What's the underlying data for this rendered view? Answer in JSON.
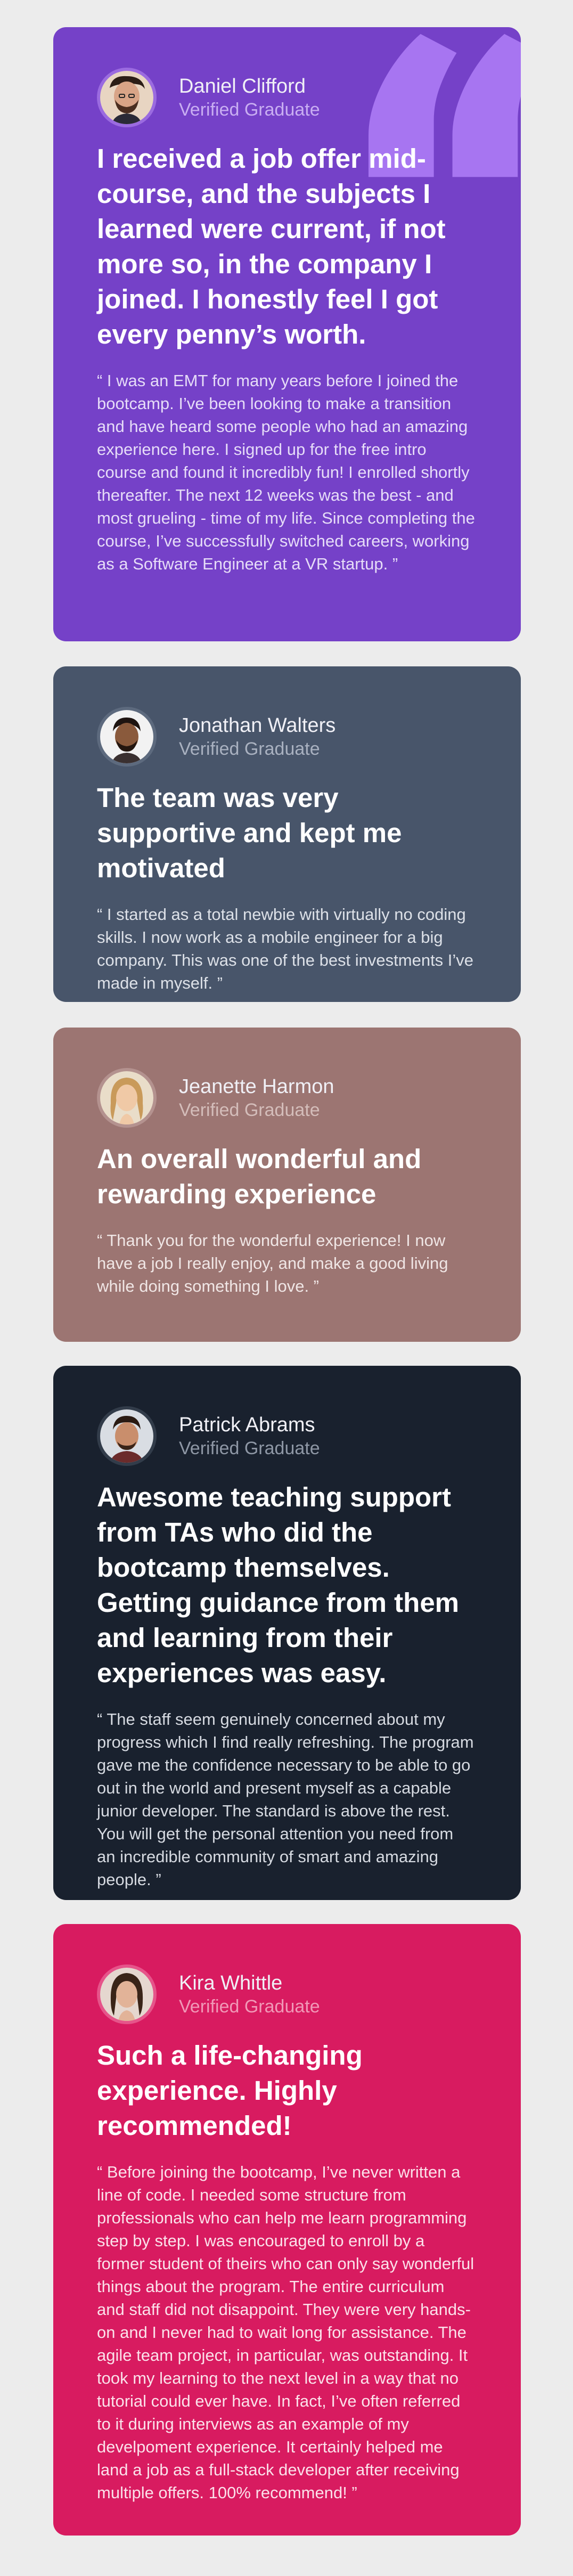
{
  "testimonials": [
    {
      "name": "Daniel Clifford",
      "role": "Verified Graduate",
      "headline": "I received a job offer mid-course, and the subjects I learned were current, if not more so, in the company I joined. I honestly feel I got every penny’s worth.",
      "quote": "“ I was an EMT for many years before I joined the bootcamp. I’ve been looking to make a transition and have heard some people who had an amazing experience here. I signed up for the free intro course and found it incredibly fun! I enrolled shortly thereafter. The next 12 weeks was the best - and most grueling - time of my life. Since completing the course, I’ve successfully switched careers, working as a Software Engineer at a VR startup. ”",
      "background": "#7541c8"
    },
    {
      "name": "Jonathan Walters",
      "role": "Verified Graduate",
      "headline": "The team was very supportive and kept me motivated",
      "quote": "“ I started as a total newbie with virtually no coding skills. I now work as a mobile engineer for a big company. This was one of the best investments I’ve made in myself. ”",
      "background": "#48556a"
    },
    {
      "name": "Jeanette Harmon",
      "role": "Verified Graduate",
      "headline": "An overall wonderful and rewarding experience",
      "quote": "“ Thank you for the wonderful experience! I now have a job I really enjoy, and make a good living while doing something I love. ”",
      "background": "#9c7572"
    },
    {
      "name": "Patrick Abrams",
      "role": "Verified Graduate",
      "headline": "Awesome teaching support from TAs who did the bootcamp themselves. Getting guidance from them and learning from their experiences was easy.",
      "quote": "“ The staff seem genuinely concerned about my progress which I find really refreshing. The program gave me the confidence necessary to be able to go out in the world and present myself as a capable junior developer. The standard is above the rest. You will get the personal attention you need from an incredible community of smart and amazing people. ”",
      "background": "#19212e"
    },
    {
      "name": "Kira Whittle",
      "role": "Verified Graduate",
      "headline": "Such a life-changing experience. Highly recommended!",
      "quote": "“ Before joining the bootcamp, I’ve never written a line of code. I needed some structure from professionals who can help me learn programming step by step. I was encouraged to enroll by a former student of theirs who can only say wonderful things about the program. The entire curriculum and staff did not disappoint. They were very hands-on and I never had to wait long for assistance. The agile team project, in particular, was outstanding. It took my learning to the next level in a way that no tutorial could ever have. In fact, I’ve often referred to it during interviews as an example of my develpoment experience. It certainly helped me land a job as a full-stack developer after receiving multiple offers. 100% recommend! ”",
      "background": "#d81b60"
    }
  ],
  "icons": {
    "quote": "quote-icon",
    "avatar": "avatar"
  },
  "colors": {
    "page_background": "#ececec",
    "quote_mark": "#a775f1"
  }
}
